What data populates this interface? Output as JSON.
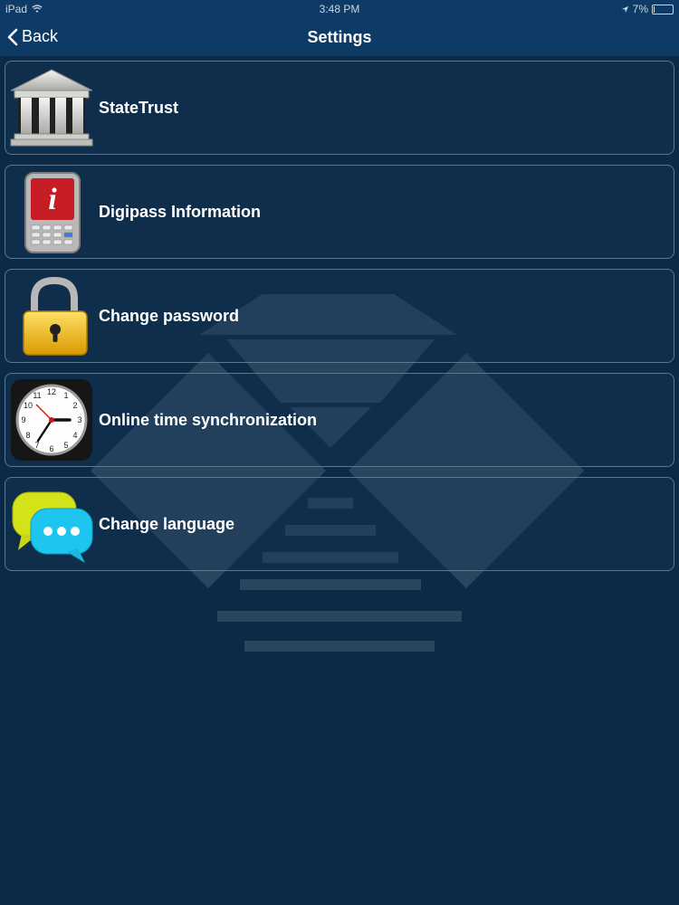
{
  "status": {
    "device": "iPad",
    "time": "3:48 PM",
    "battery": "7%",
    "battery_level": 0.07
  },
  "nav": {
    "back_label": "Back",
    "title": "Settings"
  },
  "items": [
    {
      "label": "StateTrust",
      "icon": "bank-building-icon"
    },
    {
      "label": "Digipass Information",
      "icon": "digipass-info-icon"
    },
    {
      "label": "Change password",
      "icon": "padlock-icon"
    },
    {
      "label": "Online time synchronization",
      "icon": "clock-icon"
    },
    {
      "label": "Change language",
      "icon": "chat-bubbles-icon"
    }
  ],
  "colors": {
    "background": "#0c2a45",
    "navbar": "#0e3b66",
    "row_border": "#5b7791"
  }
}
